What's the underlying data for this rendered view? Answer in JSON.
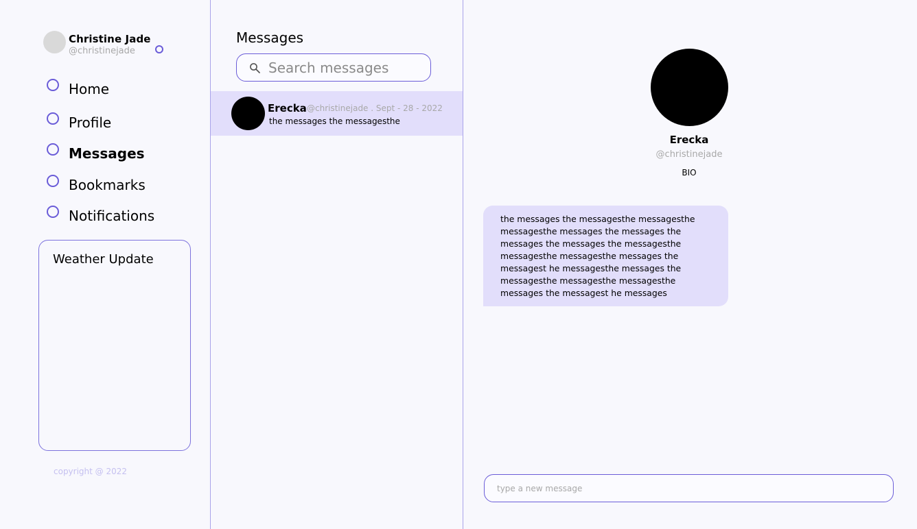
{
  "user": {
    "name": "Christine Jade",
    "handle": "@christinejade"
  },
  "nav": {
    "items": [
      {
        "label": "Home",
        "active": false
      },
      {
        "label": "Profile",
        "active": false
      },
      {
        "label": "Messages",
        "active": true
      },
      {
        "label": "Bookmarks",
        "active": false
      },
      {
        "label": "Notifications",
        "active": false
      }
    ]
  },
  "weather": {
    "title": "Weather Update"
  },
  "footer": {
    "copyright": "copyright @ 2022"
  },
  "messages_list": {
    "heading": "Messages",
    "search_placeholder": "Search messages",
    "conversations": [
      {
        "name": "Erecka",
        "meta": "@christinejade . Sept - 28 - 2022",
        "preview": "the messages the messagesthe"
      }
    ]
  },
  "chat": {
    "profile": {
      "name": "Erecka",
      "handle": "@christinejade",
      "bio": "BIO"
    },
    "message_lines": [
      "the messages the messagesthe messagesthe",
      "messagesthe messages the messages the",
      "messages the messages the messagesthe",
      "messagesthe messagesthe messages the",
      "messagest he messagesthe messages the",
      "messagesthe messagesthe messagesthe",
      "messages the messagest he messages"
    ],
    "composer_placeholder": "type a new message"
  },
  "colors": {
    "accent": "#6a5cd8",
    "highlight": "#e2defb",
    "background": "#f8f8fd"
  }
}
